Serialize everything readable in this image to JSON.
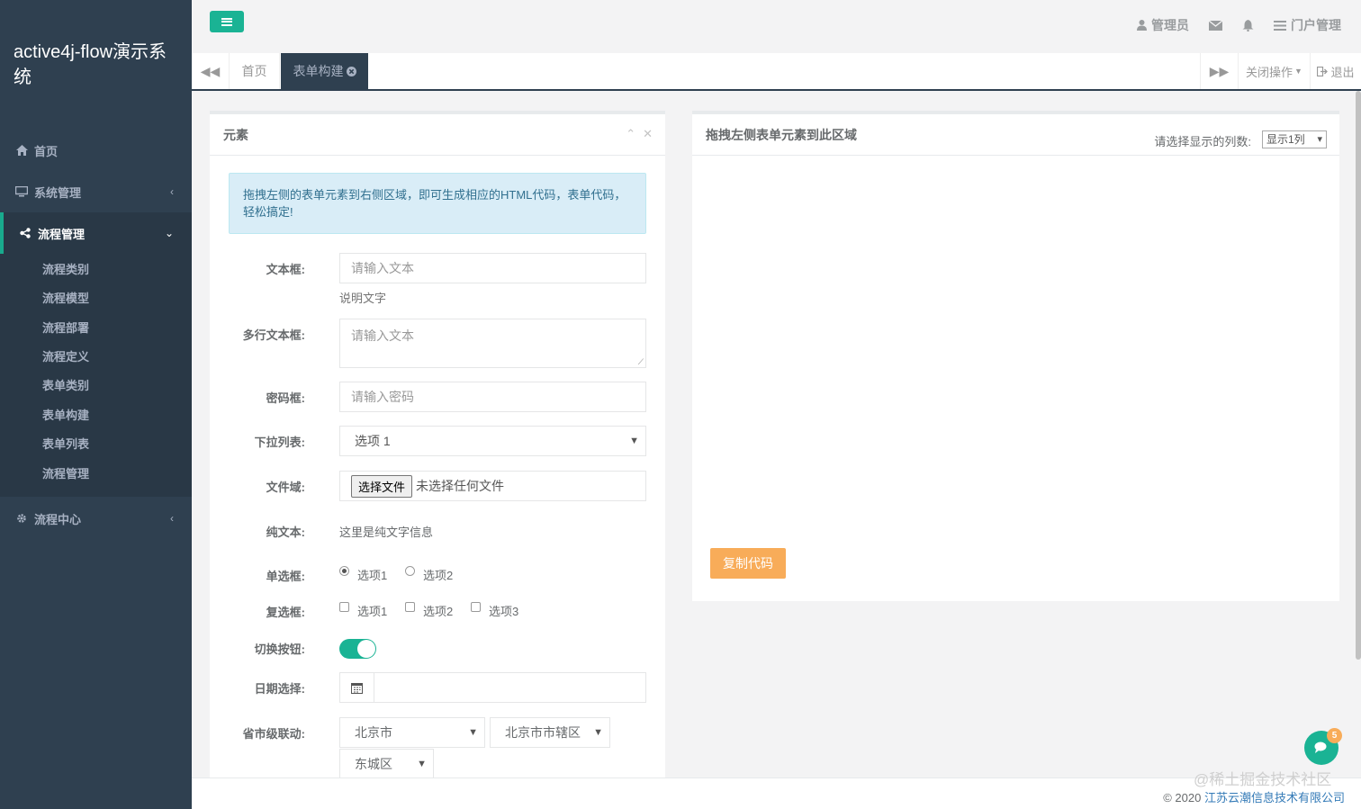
{
  "sidebar": {
    "brand": "active4j-flow演示系统",
    "items": [
      {
        "label": "首页",
        "icon": "home-icon"
      },
      {
        "label": "系统管理",
        "icon": "desktop-icon"
      },
      {
        "label": "流程管理",
        "icon": "share-icon"
      },
      {
        "label": "流程中心",
        "icon": "gear-icon"
      }
    ],
    "submenu": [
      "流程类别",
      "流程模型",
      "流程部署",
      "流程定义",
      "表单类别",
      "表单构建",
      "表单列表",
      "流程管理"
    ]
  },
  "header": {
    "admin": "管理员",
    "portal": "门户管理"
  },
  "tabs": {
    "home": "首页",
    "active": "表单构建",
    "close_ops": "关闭操作",
    "logout": "退出"
  },
  "left_panel": {
    "title": "元素",
    "alert": "拖拽左侧的表单元素到右侧区域，即可生成相应的HTML代码，表单代码，轻松搞定!",
    "fields": {
      "text_label": "文本框:",
      "text_placeholder": "请输入文本",
      "text_help": "说明文字",
      "textarea_label": "多行文本框:",
      "textarea_placeholder": "请输入文本",
      "password_label": "密码框:",
      "password_placeholder": "请输入密码",
      "select_label": "下拉列表:",
      "select_value": "选项 1",
      "file_label": "文件域:",
      "file_button": "选择文件",
      "file_status": "未选择任何文件",
      "plain_label": "纯文本:",
      "plain_value": "这里是纯文字信息",
      "radio_label": "单选框:",
      "radio_options": [
        "选项1",
        "选项2"
      ],
      "radio_selected": "选项1",
      "checkbox_label": "复选框:",
      "checkbox_options": [
        "选项1",
        "选项2",
        "选项3"
      ],
      "toggle_label": "切换按钮:",
      "toggle_on": true,
      "date_label": "日期选择:",
      "date_value": "",
      "region_label": "省市级联动:",
      "province": "北京市",
      "city": "北京市市辖区",
      "district": "东城区"
    }
  },
  "right_panel": {
    "title": "拖拽左侧表单元素到此区域",
    "col_label": "请选择显示的列数:",
    "col_value": "显示1列",
    "copy_button": "复制代码"
  },
  "footer": {
    "prefix": "© 2020",
    "company": "江苏云潮信息技术有限公司",
    "watermark": "@稀土掘金技术社区"
  },
  "chat": {
    "badge": "5"
  },
  "colors": {
    "primary": "#1ab394",
    "sidebar": "#2f4050",
    "warning": "#f8ac59",
    "info_bg": "#d9edf7"
  }
}
